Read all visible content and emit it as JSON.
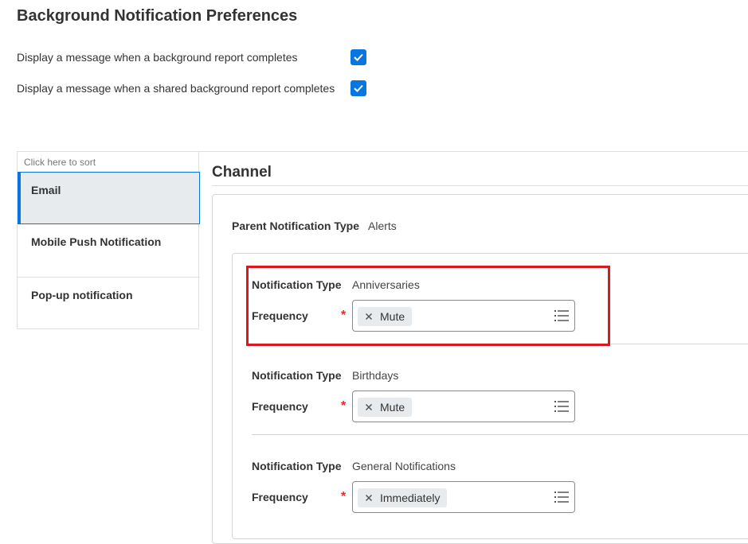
{
  "page": {
    "title": "Background Notification Preferences"
  },
  "preferences": [
    {
      "label": "Display a message when a background report completes",
      "checked": true
    },
    {
      "label": "Display a message when a shared background report completes",
      "checked": true
    }
  ],
  "channel_list": {
    "sort_hint": "Click here to sort",
    "items": [
      {
        "label": "Email",
        "selected": true
      },
      {
        "label": "Mobile Push Notification",
        "selected": false
      },
      {
        "label": "Pop-up notification",
        "selected": false
      }
    ]
  },
  "channel_panel": {
    "heading": "Channel",
    "parent_type_label": "Parent Notification Type",
    "parent_type_value": "Alerts",
    "notification_type_label": "Notification Type",
    "frequency_label": "Frequency",
    "required_marker": "*",
    "sections": [
      {
        "type": "Anniversaries",
        "frequency": "Mute"
      },
      {
        "type": "Birthdays",
        "frequency": "Mute"
      },
      {
        "type": "General Notifications",
        "frequency": "Immediately"
      }
    ]
  },
  "icons": {
    "checkbox": "checkmark-icon",
    "pill_remove": "close-icon",
    "prompt": "list-icon"
  },
  "colors": {
    "accent": "#0875e1",
    "required": "#de2c2c",
    "highlight": "#d9181f",
    "pill_bg": "#e8ebee"
  }
}
